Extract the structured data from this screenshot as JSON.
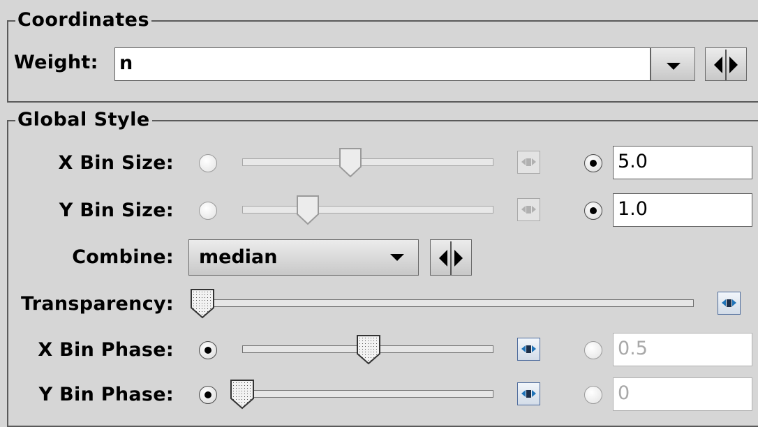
{
  "coordinates": {
    "legend": "Coordinates",
    "weight_label": "Weight:",
    "weight_value": "n"
  },
  "global_style": {
    "legend": "Global Style",
    "x_bin_size": {
      "label": "X Bin Size:",
      "value": "5.0",
      "slider_level": 0.44,
      "enabled": false,
      "text_selected": true
    },
    "y_bin_size": {
      "label": "Y Bin Size:",
      "value": "1.0",
      "slider_level": 0.26,
      "enabled": false,
      "text_selected": true
    },
    "combine": {
      "label": "Combine:",
      "selected": "median"
    },
    "transparency": {
      "label": "Transparency:",
      "slider_level": 0.0
    },
    "x_bin_phase": {
      "label": "X Bin Phase:",
      "value": "0.5",
      "slider_level": 0.5,
      "slider_selected": true
    },
    "y_bin_phase": {
      "label": "Y Bin Phase:",
      "value": "0",
      "slider_level": 0.0,
      "slider_selected": true
    }
  },
  "icons": {
    "dropdown": "chevron-down-icon",
    "cycle": "left-right-arrows-icon",
    "reset": "reset-slider-icon"
  },
  "colors": {
    "background": "#d6d6d6",
    "border": "#5a5a5a",
    "reset_icon": "#1f73b8"
  }
}
